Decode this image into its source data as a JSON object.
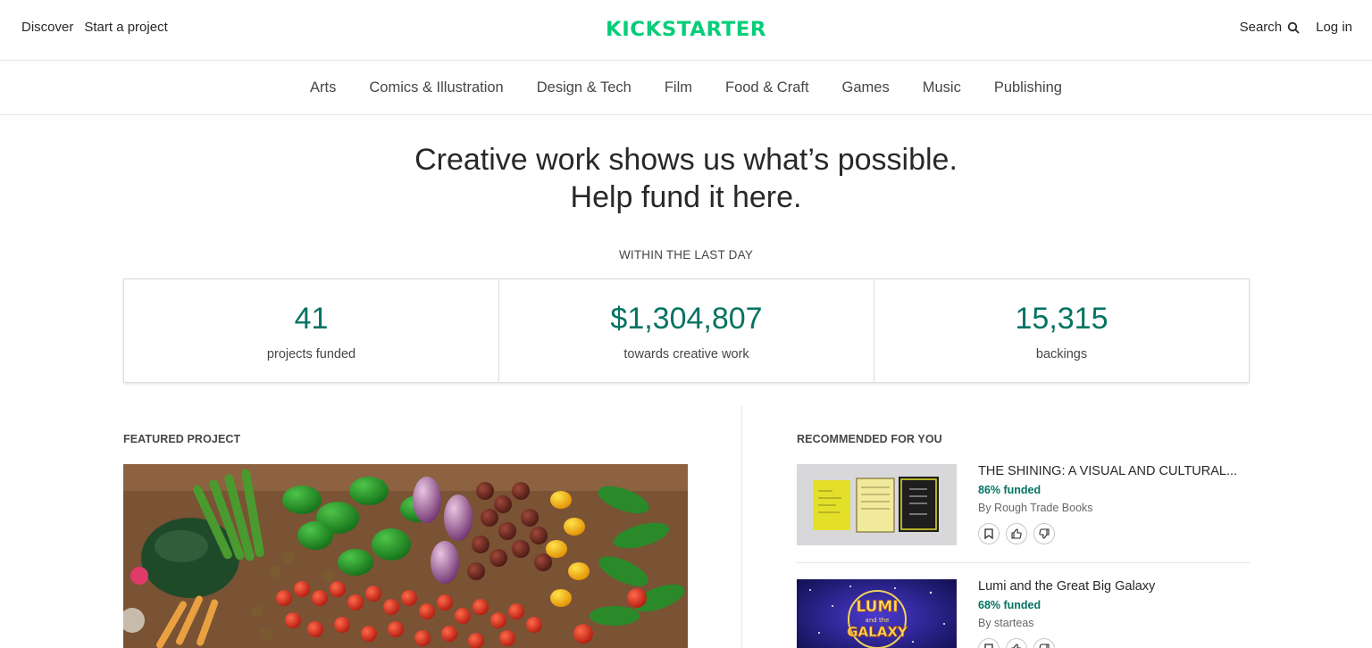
{
  "header": {
    "discover": "Discover",
    "start_project": "Start a project",
    "logo_text": "KICKSTARTER",
    "search": "Search",
    "login": "Log in"
  },
  "categories": [
    "Arts",
    "Comics & Illustration",
    "Design & Tech",
    "Film",
    "Food & Craft",
    "Games",
    "Music",
    "Publishing"
  ],
  "hero": {
    "line1": "Creative work shows us what’s possible.",
    "line2": "Help fund it here."
  },
  "stats": {
    "label": "WITHIN THE LAST DAY",
    "items": [
      {
        "value": "41",
        "label": "projects funded"
      },
      {
        "value": "$1,304,807",
        "label": "towards creative work"
      },
      {
        "value": "15,315",
        "label": "backings"
      }
    ]
  },
  "featured": {
    "label": "FEATURED PROJECT"
  },
  "recommended": {
    "label": "RECOMMENDED FOR YOU",
    "items": [
      {
        "title": "THE SHINING: A VISUAL AND CULTURAL...",
        "funded": "86% funded",
        "by": "By Rough Trade Books"
      },
      {
        "title": "Lumi and the Great Big Galaxy",
        "funded": "68% funded",
        "by": "By starteas",
        "thumb_text": "LUMI and the GALAXY"
      }
    ]
  },
  "colors": {
    "brand_green": "#05ce78",
    "stat_green": "#037362",
    "text": "#282828"
  }
}
